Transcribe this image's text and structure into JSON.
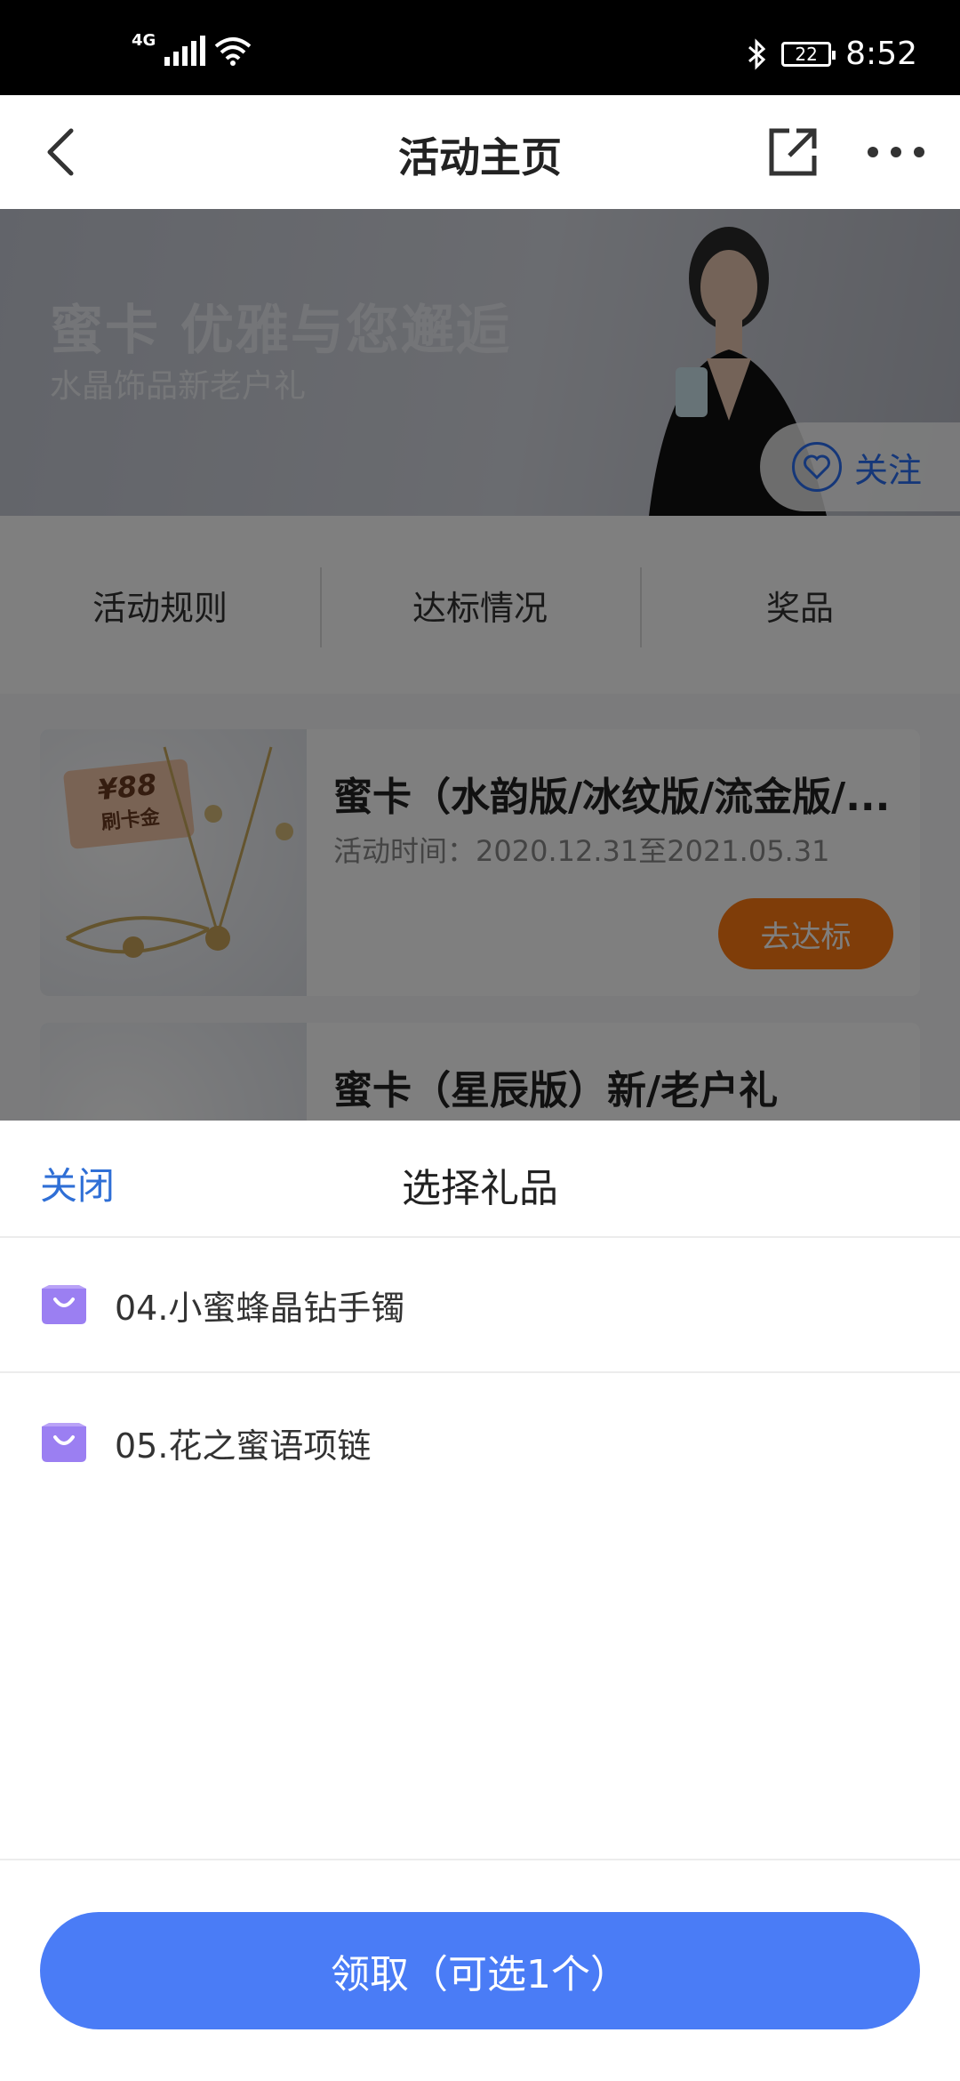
{
  "status_bar": {
    "network": "4G",
    "battery": "22",
    "time": "8:52"
  },
  "nav": {
    "title": "活动主页"
  },
  "banner": {
    "title": "蜜卡 优雅与您邂逅",
    "subtitle": "水晶饰品新老户礼",
    "follow_label": "关注"
  },
  "tabs": [
    "活动规则",
    "达标情况",
    "奖品"
  ],
  "cards": [
    {
      "tag_price": "¥88",
      "tag_name": "刷卡金",
      "title": "蜜卡（水韵版/冰纹版/流金版/...",
      "time": "活动时间：2020.12.31至2021.05.31",
      "button": "去达标"
    },
    {
      "title": "蜜卡（星辰版）新/老户礼"
    }
  ],
  "sheet": {
    "close_label": "关闭",
    "title": "选择礼品",
    "gifts": [
      "04.小蜜蜂晶钻手镯",
      "05.花之蜜语项链"
    ],
    "claim_label": "领取（可选1个）"
  },
  "colors": {
    "accent_blue": "#4a7cf6",
    "link_blue": "#2f6fd6",
    "orange": "#ff7a12",
    "bag_purple": "#9b7ff2"
  }
}
